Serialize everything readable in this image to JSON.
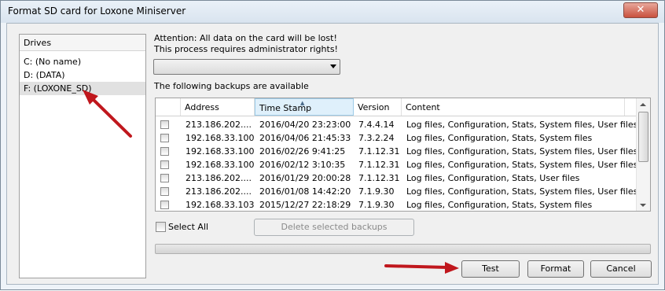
{
  "window": {
    "title": "Format SD card for Loxone Miniserver",
    "close_glyph": "✕"
  },
  "drives": {
    "header": "Drives",
    "items": [
      {
        "label": "C: (No name)"
      },
      {
        "label": "D: (DATA)"
      },
      {
        "label": "F: (LOXONE_SD)"
      }
    ]
  },
  "attention": {
    "line1": "Attention: All data on the card will be lost!",
    "line2": "This process requires administrator rights!"
  },
  "backups_label": "The following backups are available",
  "table": {
    "headers": [
      "Address",
      "Time Stamp",
      "Version",
      "Content"
    ],
    "rows": [
      {
        "address": "213.186.202....",
        "timestamp": "2016/04/20 23:23:00",
        "version": "7.4.4.14",
        "content": "Log files, Configuration, Stats, System files, User files"
      },
      {
        "address": "192.168.33.100",
        "timestamp": "2016/04/06 21:45:33",
        "version": "7.3.2.24",
        "content": "Log files, Configuration, Stats, System files"
      },
      {
        "address": "192.168.33.100",
        "timestamp": "2016/02/26 9:41:25",
        "version": "7.1.12.31",
        "content": "Log files, Configuration, Stats, System files, User files"
      },
      {
        "address": "192.168.33.100",
        "timestamp": "2016/02/12 3:10:35",
        "version": "7.1.12.31",
        "content": "Log files, Configuration, Stats, System files, User files"
      },
      {
        "address": "213.186.202....",
        "timestamp": "2016/01/29 20:00:28",
        "version": "7.1.12.31",
        "content": "Log files, Configuration, Stats, User files"
      },
      {
        "address": "213.186.202....",
        "timestamp": "2016/01/08 14:42:20",
        "version": "7.1.9.30",
        "content": "Log files, Configuration, Stats, System files, User files"
      },
      {
        "address": "192.168.33.103",
        "timestamp": "2015/12/27 22:18:29",
        "version": "7.1.9.30",
        "content": "Log files, Configuration, Stats, System files"
      }
    ]
  },
  "select_all_label": "Select All",
  "delete_button": "Delete selected backups",
  "buttons": {
    "test": "Test",
    "format": "Format",
    "cancel": "Cancel"
  },
  "progress_fraction": 0,
  "colors": {
    "annotation_arrow": "#c0171d",
    "selected_drive_bg": "#e1e1e1"
  }
}
